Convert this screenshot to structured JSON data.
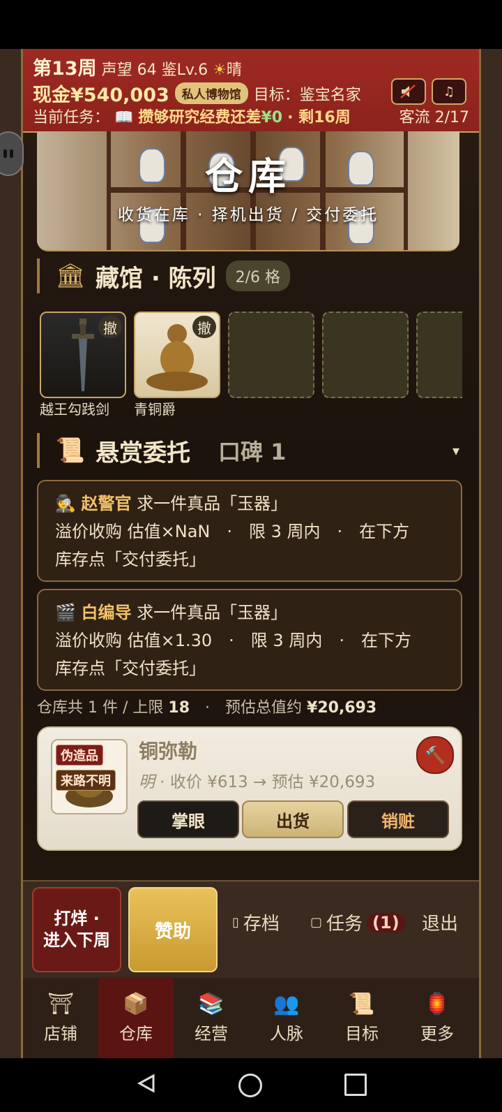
{
  "header": {
    "week": "第13周",
    "prestige": "声望 64",
    "appraise_level": "鉴Lv.6",
    "weather_icon": "sun-icon",
    "weather": "晴",
    "cash": "现金¥540,003",
    "museum_badge": "私人博物馆",
    "goal": "目标：鉴宝名家",
    "task_prefix": "当前任务：",
    "task_name": "攒够研究经费",
    "task_mid": "还差",
    "task_remaining": "¥0",
    "task_weeks": "· 剩16周",
    "visitors": "客流 2/17",
    "sound_icon": "mute-icon",
    "music_icon": "music-icon"
  },
  "banner": {
    "title": "仓库",
    "subtitle": "收货在库 · 择机出货 / 交付委托"
  },
  "exhibit": {
    "title": "藏馆 · 陈列",
    "capacity": "2/6 格",
    "remove_label": "撤",
    "items": [
      {
        "label": "越王勾践剑"
      },
      {
        "label": "青铜爵"
      }
    ]
  },
  "bounty": {
    "title": "悬赏委托",
    "reputation": "口碑 1",
    "toggle": "▾",
    "cards": [
      {
        "icon": "detective-icon",
        "name": "赵警官",
        "request": "求一件真品「玉器」",
        "line2": "溢价收购 估值×NaN　·　限 3 周内　·　在下方",
        "line3": "库存点「交付委托」"
      },
      {
        "icon": "clapper-icon",
        "name": "白编导",
        "request": "求一件真品「玉器」",
        "line2": "溢价收购 估值×1.30　·　限 3 周内　·　在下方",
        "line3": "库存点「交付委托」"
      }
    ]
  },
  "summary": {
    "prefix": "仓库共 1 件 / 上限 ",
    "limit": "18",
    "mid": "　·　预估总值约 ",
    "total": "¥20,693"
  },
  "item": {
    "tag_fake": "伪造品",
    "tag_origin": "来路不明",
    "name": "铜弥勒",
    "dynasty": "明",
    "meta": " · 收价 ¥613 → 预估 ¥20,693",
    "btn_appraise": "掌眼",
    "btn_ship": "出货",
    "btn_fence": "销赃"
  },
  "actions": {
    "next_week": "打烊 · 进入下周",
    "sponsor": "赞助",
    "save": "存档",
    "tasks": "任务",
    "task_count": "(1)",
    "quit": "退出"
  },
  "tabs": [
    {
      "label": "店铺",
      "icon": "shop-icon"
    },
    {
      "label": "仓库",
      "icon": "warehouse-icon"
    },
    {
      "label": "经营",
      "icon": "ledger-icon"
    },
    {
      "label": "人脉",
      "icon": "people-icon"
    },
    {
      "label": "目标",
      "icon": "target-icon"
    },
    {
      "label": "更多",
      "icon": "more-icon"
    }
  ],
  "colors": {
    "header_red": "#9e2a22",
    "gold": "#c9a458",
    "active_tab": "#5a1412"
  }
}
